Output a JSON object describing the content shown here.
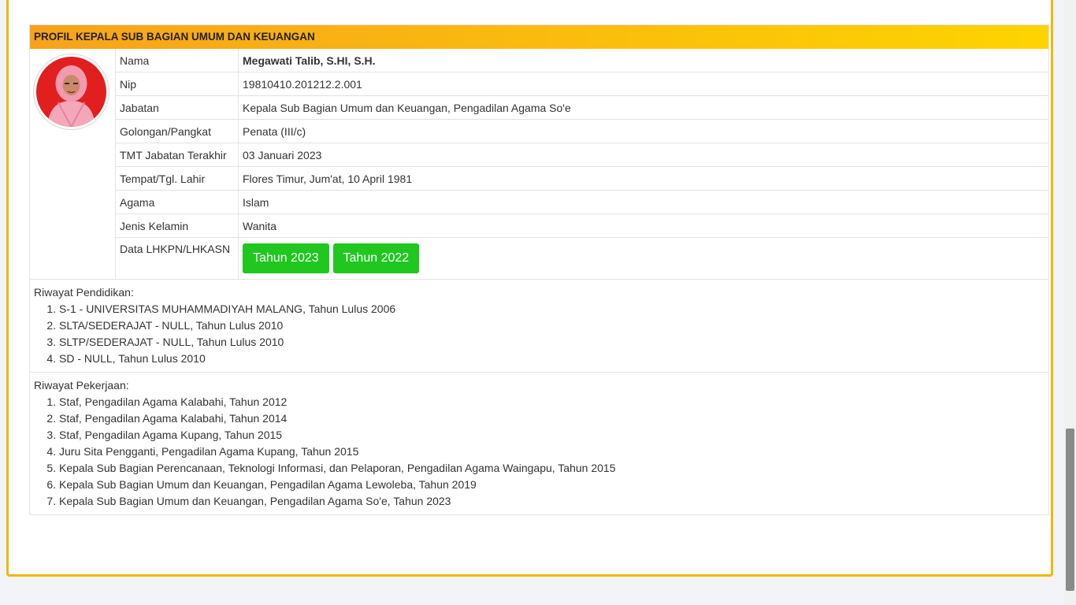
{
  "header": {
    "title": "PROFIL KEPALA SUB BAGIAN UMUM DAN KEUANGAN"
  },
  "profile": {
    "rows": [
      {
        "label": "Nama",
        "value": "Megawati Talib, S.HI, S.H."
      },
      {
        "label": "Nip",
        "value": "19810410.201212.2.001"
      },
      {
        "label": "Jabatan",
        "value": "Kepala Sub Bagian Umum dan Keuangan, Pengadilan Agama So'e"
      },
      {
        "label": "Golongan/Pangkat",
        "value": "Penata (III/c)"
      },
      {
        "label": "TMT Jabatan Terakhir",
        "value": "03 Januari 2023"
      },
      {
        "label": "Tempat/Tgl. Lahir",
        "value": "Flores Timur, Jum'at, 10 April 1981"
      },
      {
        "label": "Agama",
        "value": "Islam"
      },
      {
        "label": "Jenis Kelamin",
        "value": "Wanita"
      },
      {
        "label": "Data LHKPN/LHKASN",
        "value": ""
      }
    ],
    "lhkpn_buttons": [
      "Tahun 2023",
      "Tahun 2022"
    ]
  },
  "education": {
    "title": "Riwayat Pendidikan:",
    "items": [
      "S-1 - UNIVERSITAS MUHAMMADIYAH MALANG, Tahun Lulus 2006",
      "SLTA/SEDERAJAT - NULL, Tahun Lulus 2010",
      "SLTP/SEDERAJAT - NULL, Tahun Lulus 2010",
      "SD - NULL, Tahun Lulus 2010"
    ]
  },
  "work": {
    "title": "Riwayat Pekerjaan:",
    "items": [
      "Staf, Pengadilan Agama Kalabahi, Tahun 2012",
      "Staf, Pengadilan Agama Kalabahi, Tahun 2014",
      "Staf, Pengadilan Agama Kupang, Tahun 2015",
      "Juru Sita Pengganti, Pengadilan Agama Kupang, Tahun 2015",
      "Kepala Sub Bagian Perencanaan, Teknologi Informasi, dan Pelaporan, Pengadilan Agama Waingapu, Tahun 2015",
      "Kepala Sub Bagian Umum dan Keuangan, Pengadilan Agama Lewoleba, Tahun 2019",
      "Kepala Sub Bagian Umum dan Keuangan, Pengadilan Agama So'e, Tahun 2023"
    ]
  },
  "colors": {
    "header_gradient_start": "#f7a21c",
    "header_gradient_end": "#fdd400",
    "button": "#1fc71f",
    "card_border": "#f2b705"
  },
  "icons": {
    "avatar": "profile-photo"
  }
}
